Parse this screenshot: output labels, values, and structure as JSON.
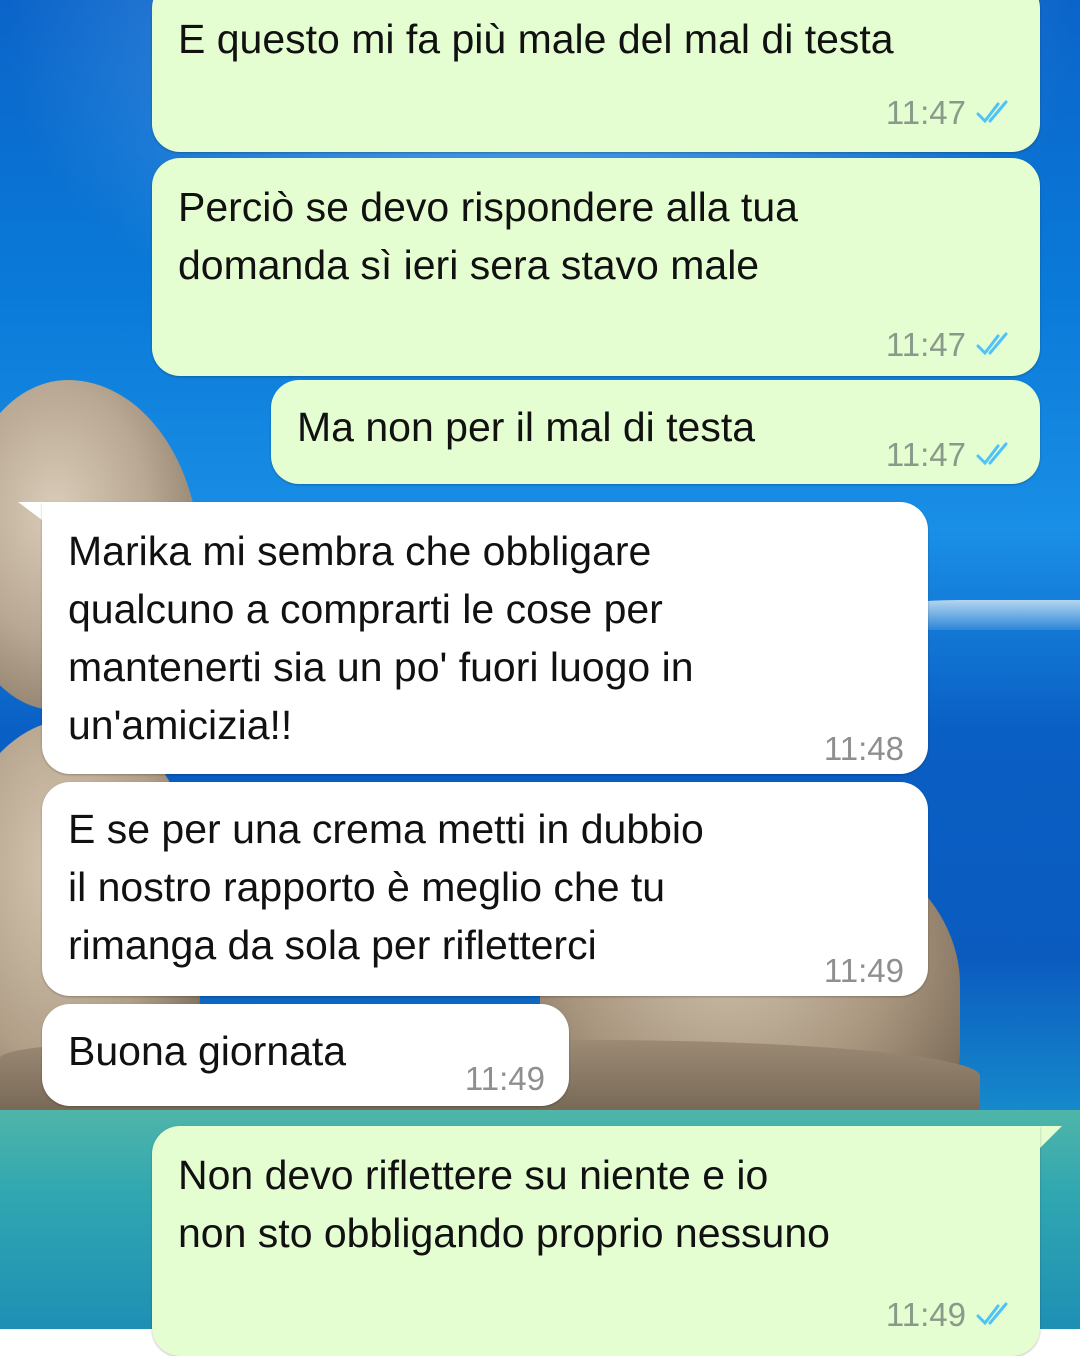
{
  "messages": [
    {
      "direction": "out",
      "text": "E questo mi fa più male del mal di testa",
      "time": "11:47",
      "status": "read"
    },
    {
      "direction": "out",
      "text": "Perciò se devo rispondere alla tua\ndomanda sì ieri sera stavo male",
      "time": "11:47",
      "status": "read"
    },
    {
      "direction": "out",
      "text": "Ma non per il mal di testa",
      "time": "11:47",
      "status": "read"
    },
    {
      "direction": "in",
      "text": "Marika mi sembra che obbligare\nqualcuno a comprarti le cose per\nmantenerti sia un po' fuori luogo in\nun'amicizia!!",
      "time": "11:48"
    },
    {
      "direction": "in",
      "text": "E se per una crema metti in dubbio\nil nostro rapporto è meglio che tu\nrimanga da sola per rifletterci",
      "time": "11:49"
    },
    {
      "direction": "in",
      "text": "Buona giornata",
      "time": "11:49"
    },
    {
      "direction": "out",
      "text": "Non devo riflettere su niente e io\nnon sto obbligando proprio nessuno",
      "time": "11:49",
      "status": "read"
    }
  ],
  "colors": {
    "outgoing_bubble": "#e4fdd1",
    "incoming_bubble": "#ffffff",
    "read_ticks": "#4fc3f7"
  },
  "icons": {
    "read_receipt": "double-check-icon"
  }
}
